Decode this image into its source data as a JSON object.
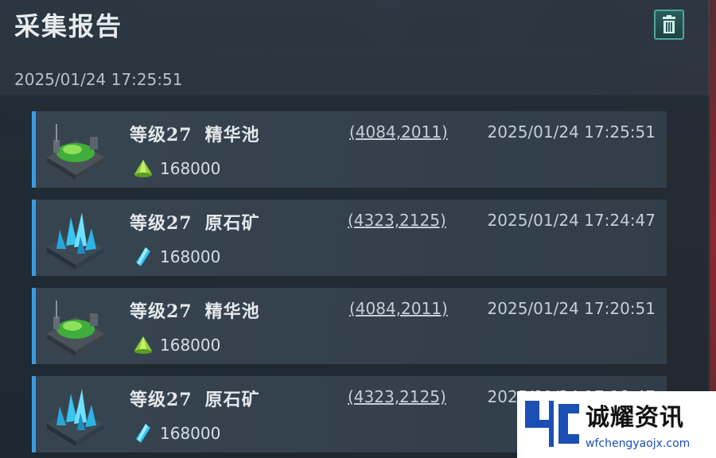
{
  "header": {
    "title": "采集报告",
    "timestamp": "2025/01/24  17:25:51",
    "delete_icon": "trash-icon"
  },
  "reports": [
    {
      "level": "等级27",
      "name": "精华池",
      "coords": "(4084,2011)",
      "time": "2025/01/24 17:25:51",
      "amount": "168000",
      "resource_icon": "essence-drop-icon",
      "thumb": "essence-pool"
    },
    {
      "level": "等级27",
      "name": "原石矿",
      "coords": "(4323,2125)",
      "time": "2025/01/24 17:24:47",
      "amount": "168000",
      "resource_icon": "crystal-icon",
      "thumb": "crystal-mine"
    },
    {
      "level": "等级27",
      "name": "精华池",
      "coords": "(4084,2011)",
      "time": "2025/01/24 17:20:51",
      "amount": "168000",
      "resource_icon": "essence-drop-icon",
      "thumb": "essence-pool"
    },
    {
      "level": "等级27",
      "name": "原石矿",
      "coords": "(4323,2125)",
      "time": "2025/01/24 17:19:47",
      "amount": "168000",
      "resource_icon": "crystal-icon",
      "thumb": "crystal-mine"
    }
  ],
  "watermark": {
    "text": "诚耀资讯",
    "url": "wfchengyaojx.com"
  },
  "colors": {
    "accent_bar": "#3c9be0",
    "trash_button": "#2b5d5b",
    "essence_green": "#8fd13a",
    "crystal_cyan": "#38c6f0"
  }
}
